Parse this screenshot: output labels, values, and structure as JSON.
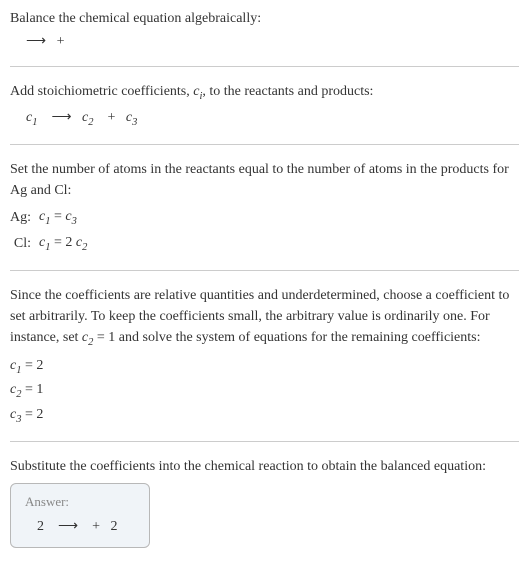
{
  "section1": {
    "intro": "Balance the chemical equation algebraically:",
    "arrow": "⟶",
    "plus": "+"
  },
  "section2": {
    "intro_a": "Add stoichiometric coefficients, ",
    "ci": "c",
    "ci_sub": "i",
    "intro_b": ", to the reactants and products:",
    "c1": "c",
    "c1_sub": "1",
    "arrow": "⟶",
    "c2": "c",
    "c2_sub": "2",
    "plus": "+",
    "c3": "c",
    "c3_sub": "3"
  },
  "section3": {
    "intro": "Set the number of atoms in the reactants equal to the number of atoms in the products for Ag and Cl:",
    "rows": [
      {
        "label": "Ag:",
        "lhs_c": "c",
        "lhs_sub": "1",
        "eq": "=",
        "rhs_c": "c",
        "rhs_sub": "3",
        "rhs_prefix": ""
      },
      {
        "label": "Cl:",
        "lhs_c": "c",
        "lhs_sub": "1",
        "eq": "=",
        "rhs_c": "c",
        "rhs_sub": "2",
        "rhs_prefix": "2 "
      }
    ]
  },
  "section4": {
    "intro_a": "Since the coefficients are relative quantities and underdetermined, choose a coefficient to set arbitrarily. To keep the coefficients small, the arbitrary value is ordinarily one. For instance, set ",
    "cset": "c",
    "cset_sub": "2",
    "cset_val": " = 1",
    "intro_b": " and solve the system of equations for the remaining coefficients:",
    "coeffs": [
      {
        "c": "c",
        "sub": "1",
        "val": " = 2"
      },
      {
        "c": "c",
        "sub": "2",
        "val": " = 1"
      },
      {
        "c": "c",
        "sub": "3",
        "val": " = 2"
      }
    ]
  },
  "section5": {
    "intro": "Substitute the coefficients into the chemical reaction to obtain the balanced equation:",
    "answer_label": "Answer:",
    "two_a": "2",
    "arrow": "⟶",
    "plus": "+",
    "two_b": "2"
  }
}
